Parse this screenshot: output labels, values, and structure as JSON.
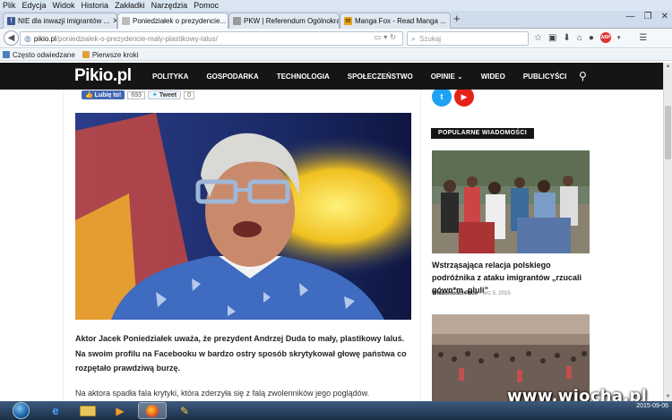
{
  "menu": {
    "items": [
      "Plik",
      "Edycja",
      "Widok",
      "Historia",
      "Zakładki",
      "Narzędzia",
      "Pomoc"
    ]
  },
  "tabs": [
    {
      "label": "NIE dla inwazji imigrantów ...",
      "active": false
    },
    {
      "label": "Poniedziałek o prezydencie...",
      "active": true
    },
    {
      "label": "PKW | Referendum Ogólnokraj...",
      "active": false
    },
    {
      "label": "Manga Fox - Read Manga ...",
      "active": false
    }
  ],
  "newtab": "+",
  "url": {
    "host": "pikio.pl",
    "path": "/poniedzialek-o-prezydencie-maly-plastikowy-lalus/"
  },
  "search": {
    "placeholder": "Szukaj"
  },
  "bookmarks": [
    "Często odwiedzane",
    "Pierwsze kroki"
  ],
  "site": {
    "logo": "Pikio",
    "logo_tld": ".pl",
    "nav": [
      "POLITYKA",
      "GOSPODARKA",
      "TECHNOLOGIA",
      "SPOŁECZEŃSTWO",
      "OPINIE ⌄",
      "WIDEO",
      "PUBLICYŚCI"
    ]
  },
  "social": {
    "fb_label": "Lubię to!",
    "fb_count": "693",
    "tw_label": "Tweet",
    "tw_count": "0"
  },
  "article": {
    "lead": "Aktor Jacek Poniedziałek uważa, że prezydent Andrzej Duda to mały, plastikowy laluś. Na swoim profilu na Facebooku w bardzo ostry sposób skrytykował głowę państwa co rozpętało prawdziwą burzę.",
    "paragraph": "Na aktora spadła fala krytyki, która zderzyła się z falą zwolenników jego poglądów. Przeciwnicy"
  },
  "sidebar": {
    "popular_label": "POPULARNE WIADOMOŚCI",
    "post_title": "Wstrząsająca relacja polskiego podróżnika z ataku imigrantów „rzucali gówn*m, pluli”",
    "post_source": "Wiadomości Pikio",
    "post_date": "wrz 5, 2015"
  },
  "taskbar": {
    "date": "2015-09-06"
  },
  "watermark": "www.wiocha.pl",
  "colors": {
    "nav_bg": "#151515",
    "fb": "#4267b2",
    "twitter": "#1da1f2",
    "youtube": "#e62117"
  }
}
